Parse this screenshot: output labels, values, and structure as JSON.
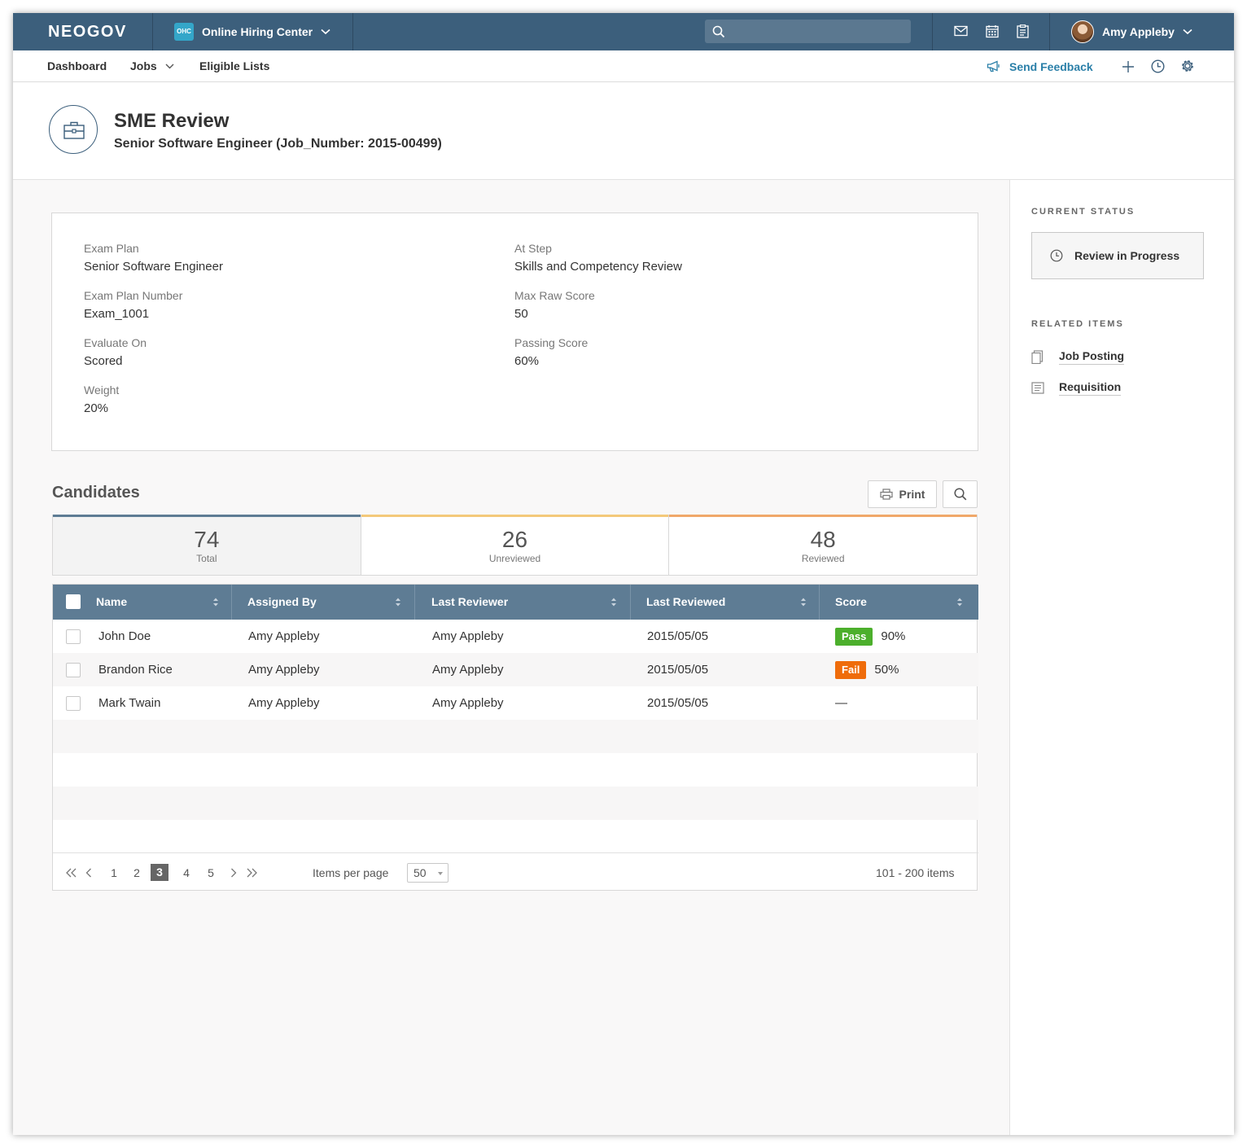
{
  "topbar": {
    "logo": "NEOGOV",
    "product_badge": "OHC",
    "product_name": "Online Hiring Center",
    "search_placeholder": "",
    "icons": [
      "mail-icon",
      "calendar-icon",
      "clipboard-icon"
    ],
    "user_name": "Amy Appleby"
  },
  "subnav": {
    "items": [
      {
        "label": "Dashboard"
      },
      {
        "label": "Jobs"
      },
      {
        "label": "Eligible Lists"
      }
    ],
    "feedback_label": "Send Feedback",
    "icons": [
      "plus-icon",
      "clock-icon",
      "gear-icon"
    ]
  },
  "header": {
    "title": "SME Review",
    "subtitle": "Senior Software Engineer (Job_Number: 2015-00499)"
  },
  "info": {
    "left": [
      {
        "label": "Exam Plan",
        "value": "Senior Software Engineer"
      },
      {
        "label": "Exam Plan Number",
        "value": "Exam_1001"
      },
      {
        "label": "Evaluate On",
        "value": "Scored"
      },
      {
        "label": "Weight",
        "value": "20%"
      }
    ],
    "right": [
      {
        "label": "At Step",
        "value": "Skills and Competency Review"
      },
      {
        "label": "Max Raw Score",
        "value": "50"
      },
      {
        "label": "Passing Score",
        "value": "60%"
      }
    ]
  },
  "sidebar": {
    "status_heading": "CURRENT STATUS",
    "status_value": "Review in Progress",
    "related_heading": "RELATED ITEMS",
    "related": [
      {
        "label": "Job Posting",
        "icon": "document-icon"
      },
      {
        "label": "Requisition",
        "icon": "list-document-icon"
      }
    ]
  },
  "candidates": {
    "title": "Candidates",
    "print_label": "Print",
    "stats": [
      {
        "value": "74",
        "label": "Total",
        "color": "#5e7c94"
      },
      {
        "value": "26",
        "label": "Unreviewed",
        "color": "#f4c97a"
      },
      {
        "value": "48",
        "label": "Reviewed",
        "color": "#f0a86a"
      }
    ],
    "columns": [
      "Name",
      "Assigned By",
      "Last Reviewer",
      "Last Reviewed",
      "Score"
    ],
    "rows": [
      {
        "name": "John Doe",
        "assigned_by": "Amy Appleby",
        "last_reviewer": "Amy Appleby",
        "last_reviewed": "2015/05/05",
        "badge": "Pass",
        "badge_color": "#4caf2c",
        "score": "90%"
      },
      {
        "name": "Brandon Rice",
        "assigned_by": "Amy Appleby",
        "last_reviewer": "Amy Appleby",
        "last_reviewed": "2015/05/05",
        "badge": "Fail",
        "badge_color": "#ef6c0b",
        "score": "50%"
      },
      {
        "name": "Mark Twain",
        "assigned_by": "Amy Appleby",
        "last_reviewer": "Amy Appleby",
        "last_reviewed": "2015/05/05",
        "badge": "",
        "badge_color": "",
        "score": "—"
      }
    ],
    "pager": {
      "pages": [
        "1",
        "2",
        "3",
        "4",
        "5"
      ],
      "current_page": "3",
      "items_per_page_label": "Items per page",
      "items_per_page": "50",
      "range": "101 - 200 items"
    }
  }
}
